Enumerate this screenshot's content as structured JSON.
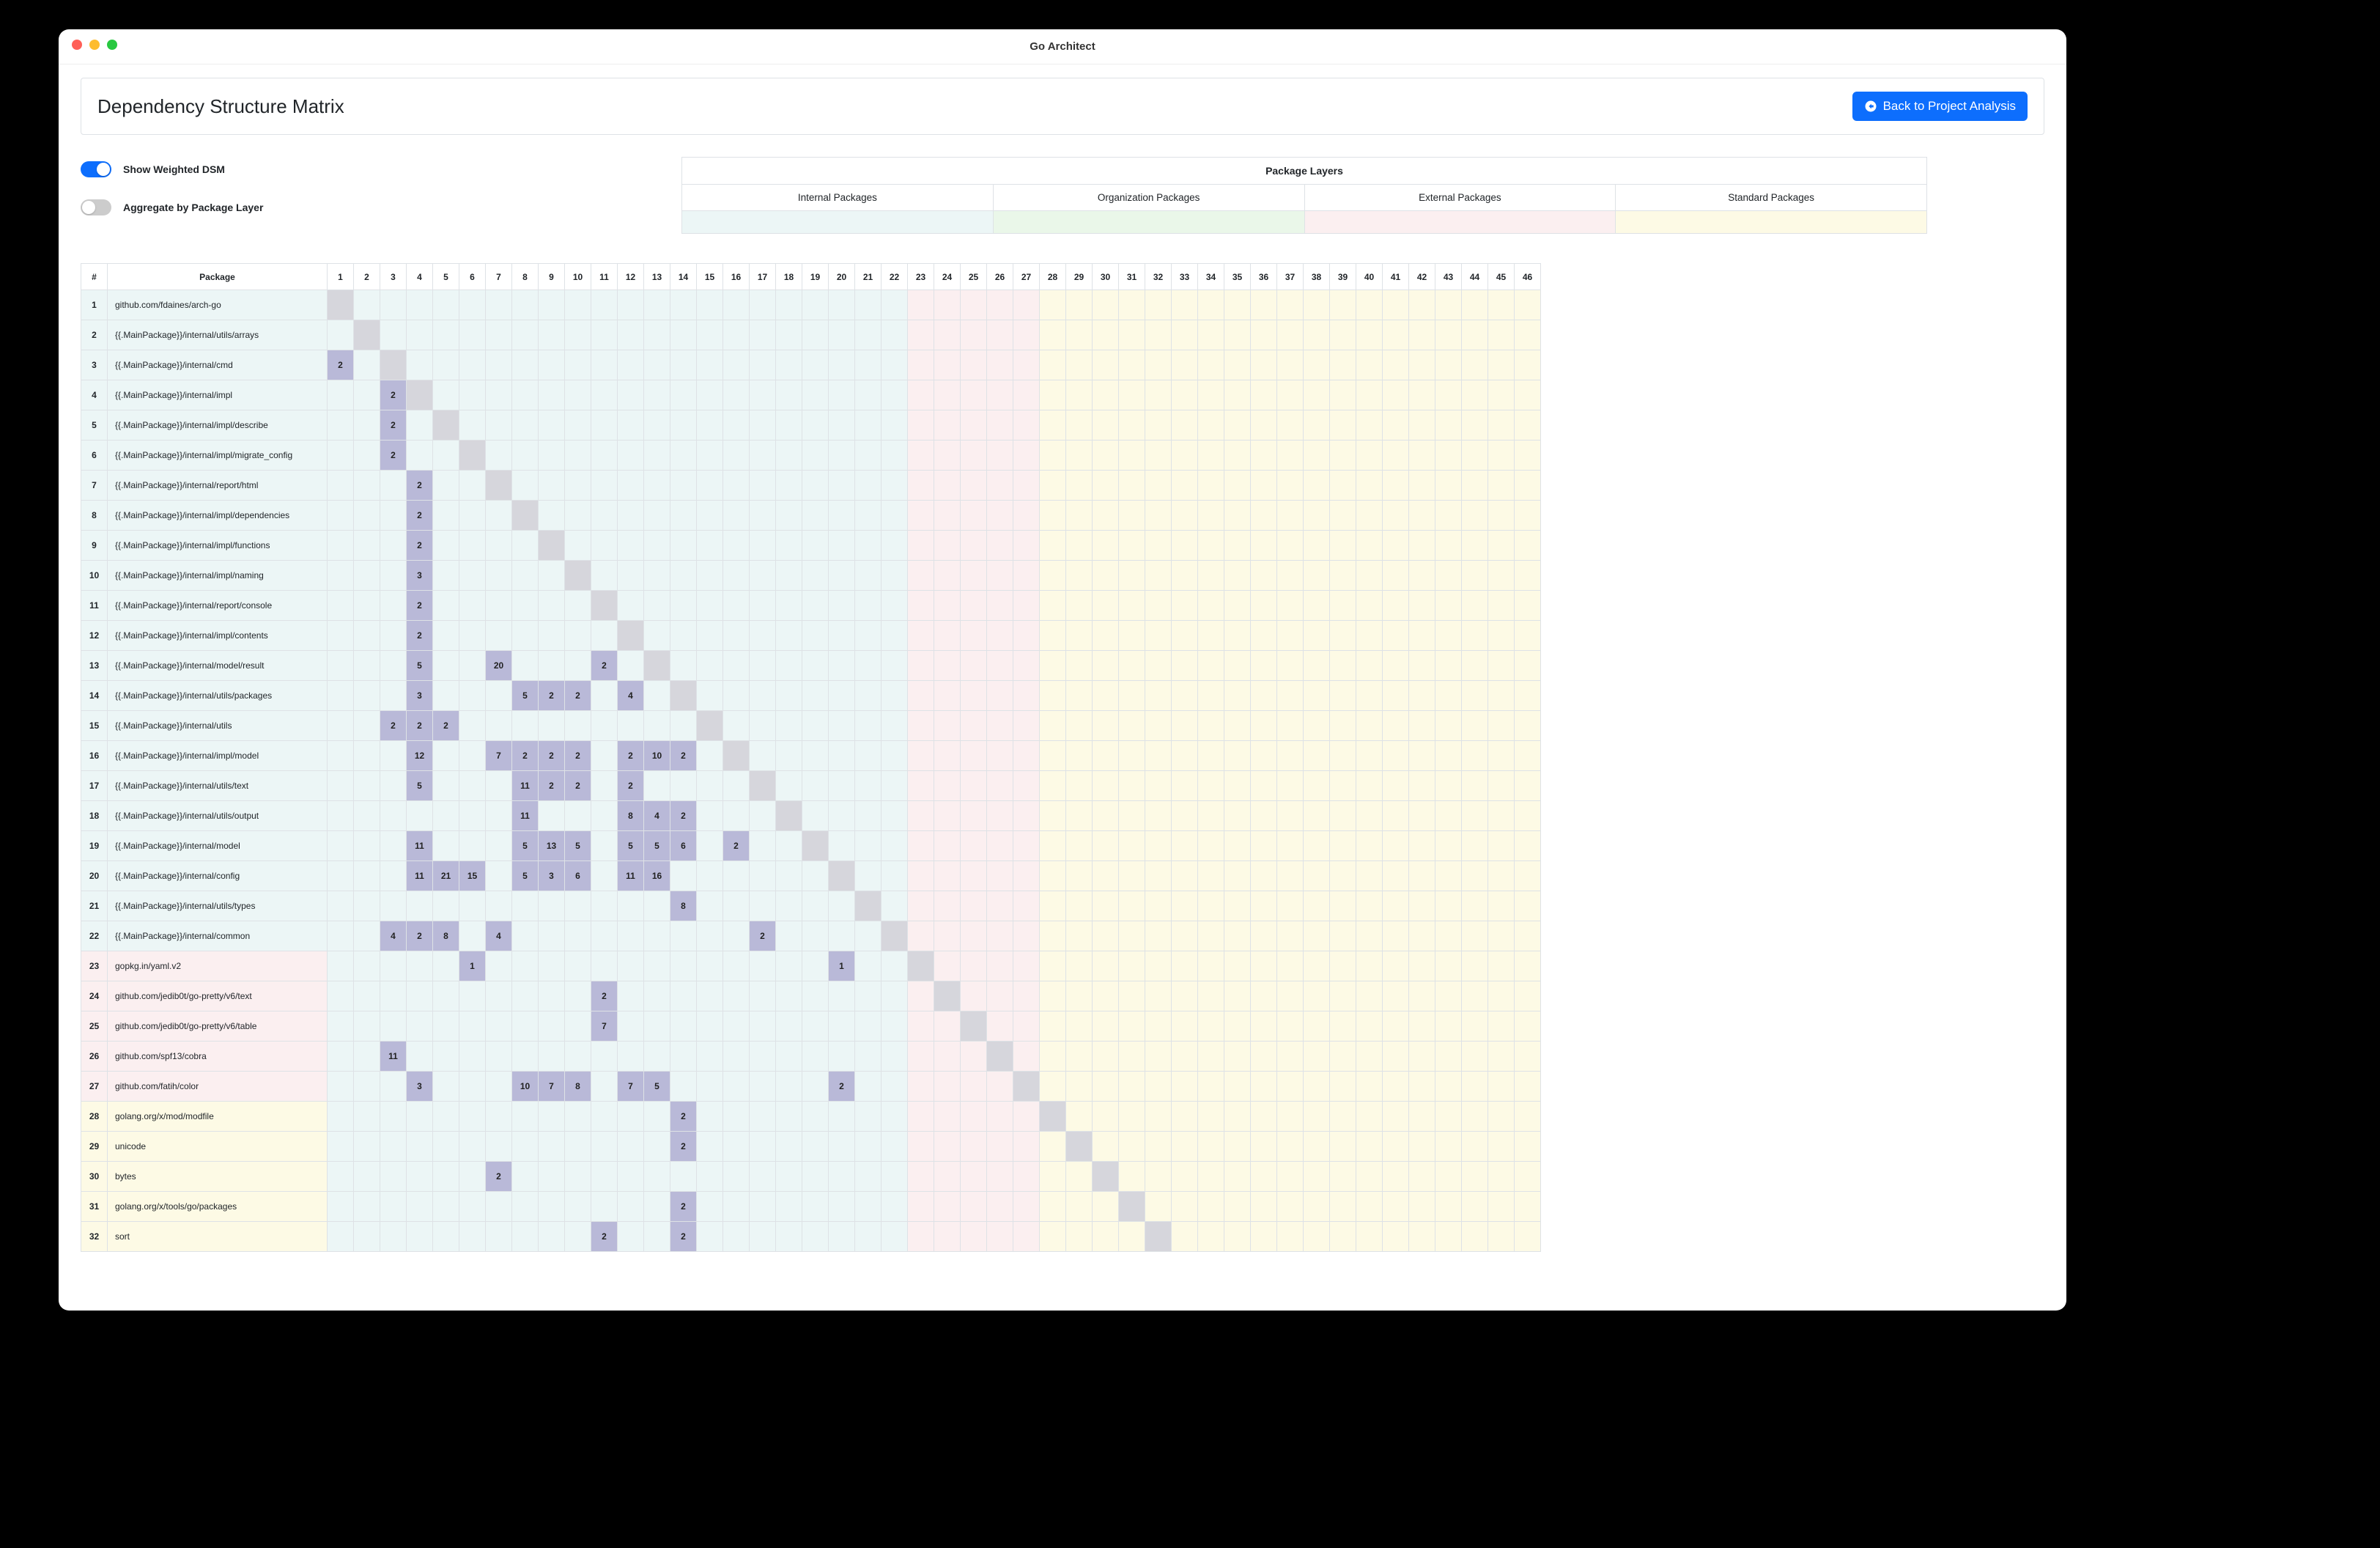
{
  "window": {
    "title": "Go Architect"
  },
  "header": {
    "title": "Dependency Structure Matrix",
    "back_label": "Back to Project Analysis"
  },
  "toggles": {
    "weighted": {
      "label": "Show Weighted DSM",
      "on": true
    },
    "aggregate": {
      "label": "Aggregate by Package Layer",
      "on": false
    }
  },
  "layers_box": {
    "title": "Package Layers",
    "cols": [
      {
        "name": "Internal Packages",
        "class": "sw-internal"
      },
      {
        "name": "Organization Packages",
        "class": "sw-org"
      },
      {
        "name": "External Packages",
        "class": "sw-ext"
      },
      {
        "name": "Standard Packages",
        "class": "sw-std"
      }
    ]
  },
  "dsm": {
    "header_num": "#",
    "header_pkg": "Package",
    "num_columns": 46,
    "column_layers": {
      "internal": [
        1,
        22
      ],
      "external": [
        23,
        27
      ],
      "standard": [
        28,
        46
      ]
    },
    "rows": [
      {
        "idx": 1,
        "layer": "internal",
        "package": "github.com/fdaines/arch-go",
        "deps": {}
      },
      {
        "idx": 2,
        "layer": "internal",
        "package": "{{.MainPackage}}/internal/utils/arrays",
        "deps": {}
      },
      {
        "idx": 3,
        "layer": "internal",
        "package": "{{.MainPackage}}/internal/cmd",
        "deps": {
          "1": 2
        }
      },
      {
        "idx": 4,
        "layer": "internal",
        "package": "{{.MainPackage}}/internal/impl",
        "deps": {
          "3": 2
        }
      },
      {
        "idx": 5,
        "layer": "internal",
        "package": "{{.MainPackage}}/internal/impl/describe",
        "deps": {
          "3": 2
        }
      },
      {
        "idx": 6,
        "layer": "internal",
        "package": "{{.MainPackage}}/internal/impl/migrate_config",
        "deps": {
          "3": 2
        }
      },
      {
        "idx": 7,
        "layer": "internal",
        "package": "{{.MainPackage}}/internal/report/html",
        "deps": {
          "4": 2
        }
      },
      {
        "idx": 8,
        "layer": "internal",
        "package": "{{.MainPackage}}/internal/impl/dependencies",
        "deps": {
          "4": 2
        }
      },
      {
        "idx": 9,
        "layer": "internal",
        "package": "{{.MainPackage}}/internal/impl/functions",
        "deps": {
          "4": 2
        }
      },
      {
        "idx": 10,
        "layer": "internal",
        "package": "{{.MainPackage}}/internal/impl/naming",
        "deps": {
          "4": 3
        }
      },
      {
        "idx": 11,
        "layer": "internal",
        "package": "{{.MainPackage}}/internal/report/console",
        "deps": {
          "4": 2
        }
      },
      {
        "idx": 12,
        "layer": "internal",
        "package": "{{.MainPackage}}/internal/impl/contents",
        "deps": {
          "4": 2
        }
      },
      {
        "idx": 13,
        "layer": "internal",
        "package": "{{.MainPackage}}/internal/model/result",
        "deps": {
          "4": 5,
          "7": 20,
          "11": 2
        }
      },
      {
        "idx": 14,
        "layer": "internal",
        "package": "{{.MainPackage}}/internal/utils/packages",
        "deps": {
          "4": 3,
          "8": 5,
          "9": 2,
          "10": 2,
          "12": 4
        }
      },
      {
        "idx": 15,
        "layer": "internal",
        "package": "{{.MainPackage}}/internal/utils",
        "deps": {
          "3": 2,
          "4": 2,
          "5": 2
        }
      },
      {
        "idx": 16,
        "layer": "internal",
        "package": "{{.MainPackage}}/internal/impl/model",
        "deps": {
          "4": 12,
          "7": 7,
          "8": 2,
          "9": 2,
          "10": 2,
          "12": 2,
          "13": 10,
          "14": 2
        }
      },
      {
        "idx": 17,
        "layer": "internal",
        "package": "{{.MainPackage}}/internal/utils/text",
        "deps": {
          "4": 5,
          "8": 11,
          "9": 2,
          "10": 2,
          "12": 2
        }
      },
      {
        "idx": 18,
        "layer": "internal",
        "package": "{{.MainPackage}}/internal/utils/output",
        "deps": {
          "8": 11,
          "12": 8,
          "13": 4,
          "14": 2
        }
      },
      {
        "idx": 19,
        "layer": "internal",
        "package": "{{.MainPackage}}/internal/model",
        "deps": {
          "4": 11,
          "8": 5,
          "9": 13,
          "10": 5,
          "12": 5,
          "13": 5,
          "14": 6,
          "16": 2
        }
      },
      {
        "idx": 20,
        "layer": "internal",
        "package": "{{.MainPackage}}/internal/config",
        "deps": {
          "4": 11,
          "5": 21,
          "6": 15,
          "8": 5,
          "9": 3,
          "10": 6,
          "12": 11,
          "13": 16
        }
      },
      {
        "idx": 21,
        "layer": "internal",
        "package": "{{.MainPackage}}/internal/utils/types",
        "deps": {
          "14": 8
        }
      },
      {
        "idx": 22,
        "layer": "internal",
        "package": "{{.MainPackage}}/internal/common",
        "deps": {
          "3": 4,
          "4": 2,
          "5": 8,
          "7": 4,
          "17": 2
        }
      },
      {
        "idx": 23,
        "layer": "external",
        "package": "gopkg.in/yaml.v2",
        "deps": {
          "6": 1,
          "20": 1
        }
      },
      {
        "idx": 24,
        "layer": "external",
        "package": "github.com/jedib0t/go-pretty/v6/text",
        "deps": {
          "11": 2
        }
      },
      {
        "idx": 25,
        "layer": "external",
        "package": "github.com/jedib0t/go-pretty/v6/table",
        "deps": {
          "11": 7
        }
      },
      {
        "idx": 26,
        "layer": "external",
        "package": "github.com/spf13/cobra",
        "deps": {
          "3": 11
        }
      },
      {
        "idx": 27,
        "layer": "external",
        "package": "github.com/fatih/color",
        "deps": {
          "4": 3,
          "8": 10,
          "9": 7,
          "10": 8,
          "12": 7,
          "13": 5,
          "20": 2
        }
      },
      {
        "idx": 28,
        "layer": "standard",
        "package": "golang.org/x/mod/modfile",
        "deps": {
          "14": 2
        }
      },
      {
        "idx": 29,
        "layer": "standard",
        "package": "unicode",
        "deps": {
          "14": 2
        }
      },
      {
        "idx": 30,
        "layer": "standard",
        "package": "bytes",
        "deps": {
          "7": 2
        }
      },
      {
        "idx": 31,
        "layer": "standard",
        "package": "golang.org/x/tools/go/packages",
        "deps": {
          "14": 2
        }
      },
      {
        "idx": 32,
        "layer": "standard",
        "package": "sort",
        "deps": {
          "11": 2,
          "14": 2
        }
      }
    ]
  }
}
